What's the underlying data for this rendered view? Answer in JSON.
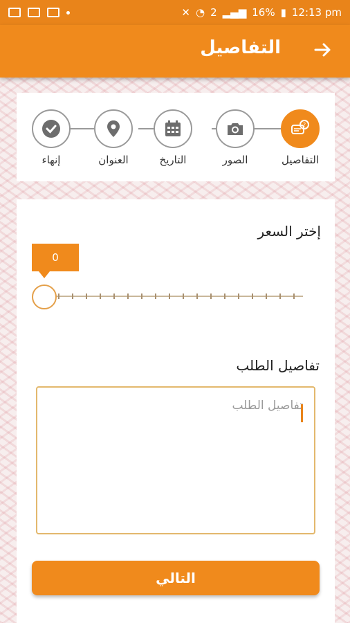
{
  "status_bar": {
    "battery": "16%",
    "time": "12:13 pm",
    "sim": "2"
  },
  "app_bar": {
    "title": "التفاصيل"
  },
  "stepper": {
    "steps": [
      {
        "label": "التفاصيل",
        "icon": "chat-question-icon",
        "active": true
      },
      {
        "label": "الصور",
        "icon": "camera-icon",
        "active": false
      },
      {
        "label": "التاريخ",
        "icon": "calendar-icon",
        "active": false
      },
      {
        "label": "العنوان",
        "icon": "location-pin-icon",
        "active": false
      },
      {
        "label": "إنهاء",
        "icon": "check-circle-icon",
        "active": false
      }
    ]
  },
  "form": {
    "price_label": "إختر السعر",
    "price_value": "0",
    "details_label": "تفاصيل الطلب",
    "details_placeholder": "تفاصيل الطلب",
    "details_value": ""
  },
  "next_button": {
    "label": "التالي"
  },
  "colors": {
    "accent": "#f08a1c",
    "status_bar": "#e9841a"
  }
}
